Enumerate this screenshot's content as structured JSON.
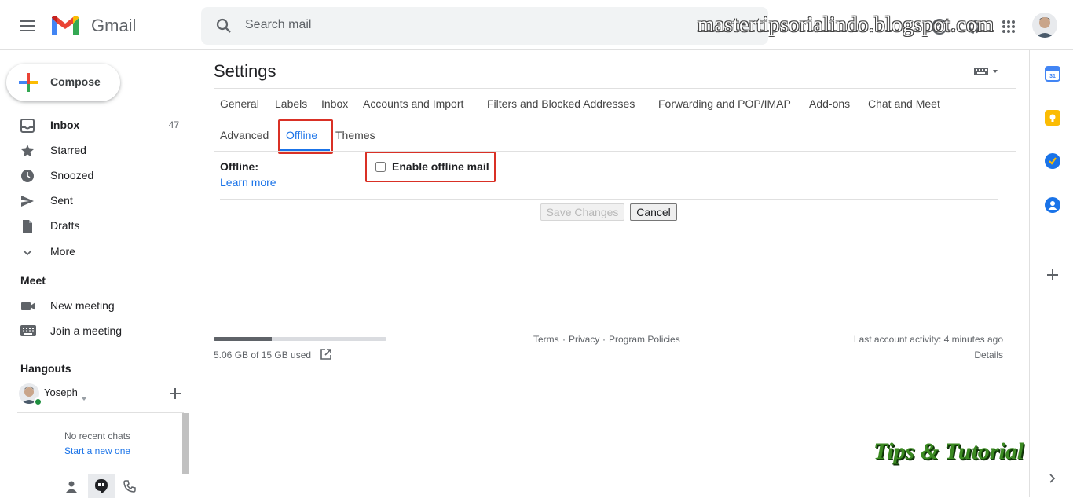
{
  "header": {
    "app_name": "Gmail",
    "search_placeholder": "Search mail",
    "watermark": "mastertipsorialindo.blogspot.com"
  },
  "sidebar": {
    "compose_label": "Compose",
    "items": [
      {
        "label": "Inbox",
        "count": "47",
        "icon": "inbox-icon"
      },
      {
        "label": "Starred",
        "icon": "star-icon"
      },
      {
        "label": "Snoozed",
        "icon": "clock-icon"
      },
      {
        "label": "Sent",
        "icon": "send-icon"
      },
      {
        "label": "Drafts",
        "icon": "draft-icon"
      },
      {
        "label": "More",
        "icon": "chevron-down-icon"
      }
    ],
    "meet": {
      "title": "Meet",
      "new_meeting": "New meeting",
      "join_meeting": "Join a meeting"
    },
    "hangouts": {
      "title": "Hangouts",
      "user": "Yoseph",
      "no_chats": "No recent chats",
      "start_new": "Start a new one"
    }
  },
  "settings": {
    "title": "Settings",
    "tabs": [
      "General",
      "Labels",
      "Inbox",
      "Accounts and Import",
      "Filters and Blocked Addresses",
      "Forwarding and POP/IMAP",
      "Add-ons",
      "Chat and Meet"
    ],
    "tabs_row2": [
      "Advanced",
      "Offline",
      "Themes"
    ],
    "active_tab": "Offline",
    "offline_label": "Offline:",
    "learn_more": "Learn more",
    "enable_offline": "Enable offline mail",
    "save_changes": "Save Changes",
    "cancel": "Cancel"
  },
  "footer": {
    "storage_used": "5.06 GB of 15 GB used",
    "storage_fraction": 0.337,
    "terms": "Terms",
    "privacy": "Privacy",
    "program_policies": "Program Policies",
    "sep": "·",
    "last_activity": "Last account activity: 4 minutes ago",
    "details": "Details"
  },
  "overlay": {
    "tips_logo": "Tips & Tutorial"
  },
  "colors": {
    "accent": "#1a73e8",
    "highlight_box": "#d93025",
    "online_dot": "#1e8e3e"
  }
}
